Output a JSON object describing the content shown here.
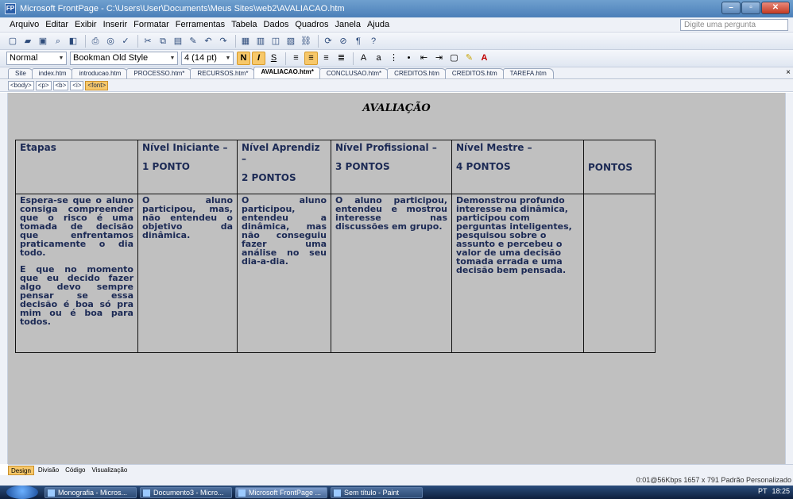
{
  "window": {
    "title": "Microsoft FrontPage - C:\\Users\\User\\Documents\\Meus Sites\\web2\\AVALIACAO.htm",
    "app_icon": "FP"
  },
  "menu": {
    "items": [
      "Arquivo",
      "Editar",
      "Exibir",
      "Inserir",
      "Formatar",
      "Ferramentas",
      "Tabela",
      "Dados",
      "Quadros",
      "Janela",
      "Ajuda"
    ],
    "help_placeholder": "Digite uma pergunta"
  },
  "format_toolbar": {
    "style": "Normal",
    "font": "Bookman Old Style",
    "size": "4 (14 pt)"
  },
  "tabs": [
    "Site",
    "index.htm",
    "introducao.htm",
    "PROCESSO.htm*",
    "RECURSOS.htm*",
    "AVALIACAO.htm*",
    "CONCLUSAO.htm*",
    "CREDITOS.htm",
    "CREDITOS.htm",
    "TAREFA.htm"
  ],
  "tags": [
    "<body>",
    "<p>",
    "<b>",
    "<i>",
    "<font>"
  ],
  "page": {
    "heading": "AVALIAÇÃO",
    "table": {
      "headers": [
        {
          "title": "Etapas",
          "sub": ""
        },
        {
          "title": "Nível Iniciante –",
          "sub": "1 PONTO"
        },
        {
          "title": "Nível Aprendiz –",
          "sub": "2 PONTOS"
        },
        {
          "title": "Nível Profissional –",
          "sub": "3 PONTOS"
        },
        {
          "title": "Nível Mestre –",
          "sub": "4 PONTOS"
        },
        {
          "title": "",
          "sub": "PONTOS"
        }
      ],
      "row": {
        "etapas_p1": "Espera-se que o aluno consiga compreender que o risco é uma tomada de decisão que enfrentamos praticamente o dia todo.",
        "etapas_p2": "E que no momento que eu decido fazer algo devo sempre pensar se essa decisão é boa só pra mim ou é boa para todos.",
        "iniciante": "O aluno participou, mas, não entendeu o objetivo da dinâmica.",
        "aprendiz": "O aluno participou, entendeu a dinâmica, mas não conseguiu fazer uma análise no seu dia-a-dia.",
        "profissional": "O aluno participou, entendeu e mostrou interesse nas discussões em grupo.",
        "mestre": "Demonstrou profundo interesse na dinâmica, participou com perguntas inteligentes, pesquisou sobre o assunto e percebeu o valor de uma decisão tomada errada e uma decisão bem pensada.",
        "pontos": ""
      }
    }
  },
  "view_tabs": [
    "Design",
    "Divisão",
    "Código",
    "Visualização"
  ],
  "status": "0:01@56Kbps  1657 x 791  Padrão  Personalizado",
  "taskbar": {
    "tasks": [
      "Monografia - Micros...",
      "Documento3 - Micro...",
      "Microsoft FrontPage ...",
      "Sem título - Paint"
    ],
    "tray": [
      "PT",
      "18:25"
    ]
  }
}
